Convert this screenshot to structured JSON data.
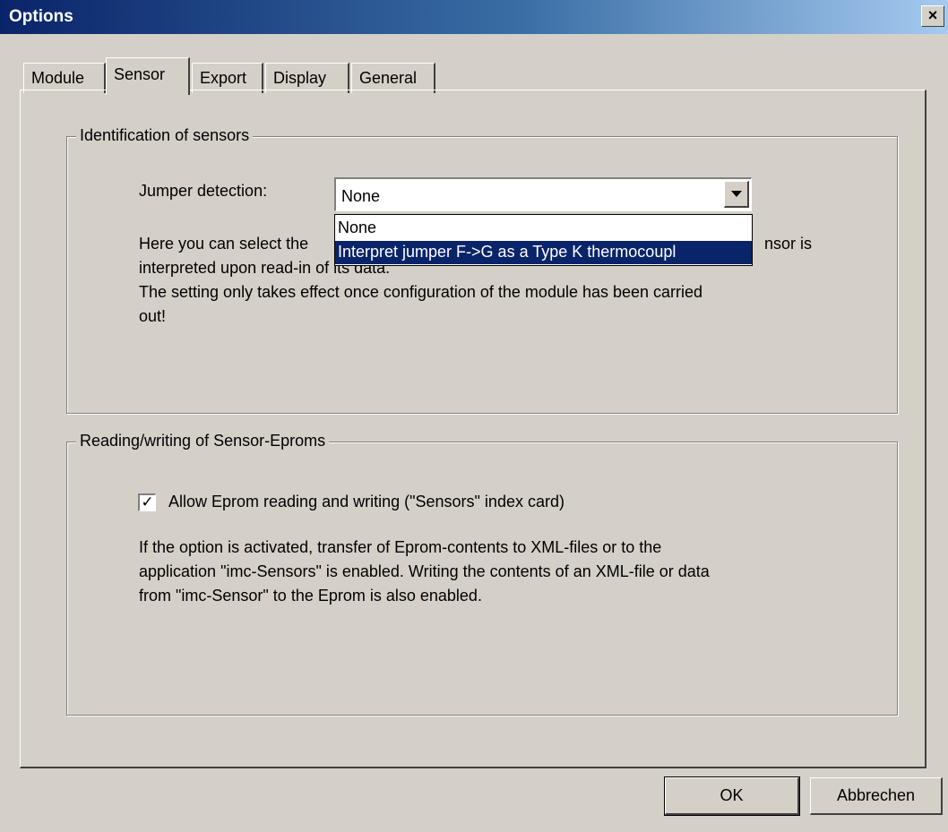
{
  "window": {
    "title": "Options",
    "close_label": "×"
  },
  "tabs": [
    {
      "label": "Module"
    },
    {
      "label": "Sensor"
    },
    {
      "label": "Export"
    },
    {
      "label": "Display"
    },
    {
      "label": "General"
    }
  ],
  "active_tab": "Sensor",
  "identification": {
    "legend": "Identification of sensors",
    "jumper_label": "Jumper detection:",
    "combo_value": "None",
    "dropdown_options": [
      "None",
      "Interpret jumper F->G as a Type K thermocoupl"
    ],
    "selected_option_index": 1,
    "desc_line1_left": "Here you can select the",
    "desc_line1_right": "nsor is",
    "desc_line2": "interpreted upon read-in of its data.",
    "desc_line3": "The setting only takes effect once configuration of the module has been carried",
    "desc_line4": "out!"
  },
  "eprom": {
    "legend": "Reading/writing of Sensor-Eproms",
    "checkbox_checked": true,
    "checkbox_mark": "✓",
    "checkbox_label": "Allow Eprom reading and writing (\"Sensors\" index card)",
    "desc_line1": "If the option is activated, transfer of Eprom-contents to XML-files or to the",
    "desc_line2": "application \"imc-Sensors\" is enabled. Writing the contents of an XML-file or data",
    "desc_line3": "from \"imc-Sensor\" to the Eprom is also enabled."
  },
  "buttons": {
    "ok": "OK",
    "cancel": "Abbrechen"
  }
}
